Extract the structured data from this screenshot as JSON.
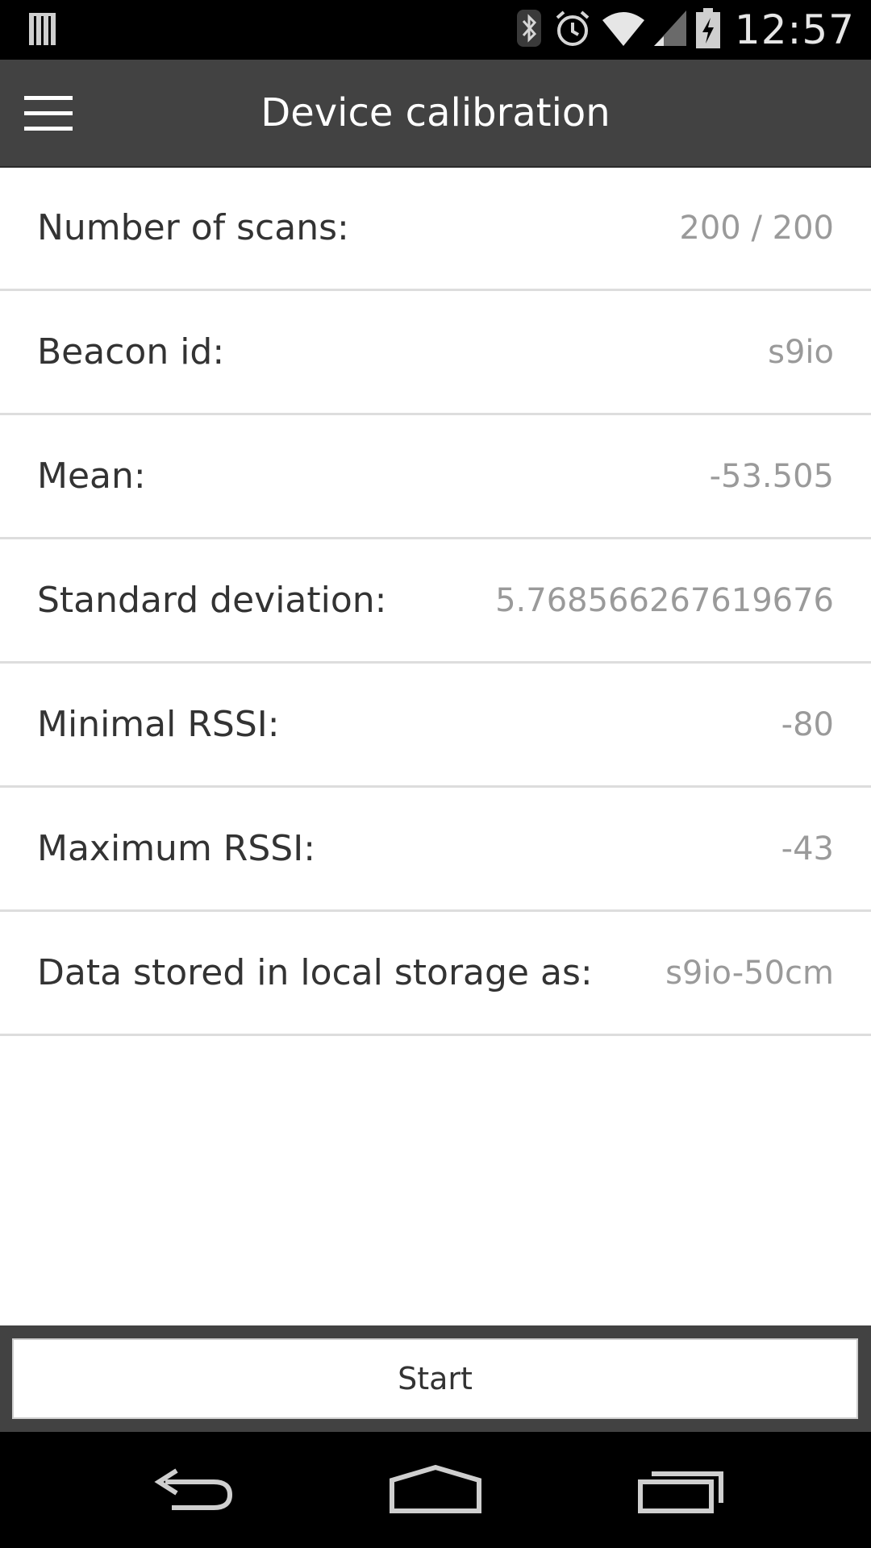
{
  "status_bar": {
    "time": "12:57",
    "icons": [
      "notification-icon",
      "bluetooth-icon",
      "alarm-icon",
      "wifi-icon",
      "signal-icon",
      "battery-charging-icon"
    ]
  },
  "app_bar": {
    "title": "Device calibration",
    "menu_icon": "hamburger-menu-icon"
  },
  "rows": [
    {
      "label": "Number of scans:",
      "value": "200 / 200"
    },
    {
      "label": "Beacon id:",
      "value": "s9io"
    },
    {
      "label": "Mean:",
      "value": "-53.505"
    },
    {
      "label": "Standard deviation:",
      "value": "5.768566267619676"
    },
    {
      "label": "Minimal RSSI:",
      "value": "-80"
    },
    {
      "label": "Maximum RSSI:",
      "value": "-43"
    },
    {
      "label": "Data stored in local storage as:",
      "value": "s9io-50cm"
    }
  ],
  "actions": {
    "start_label": "Start"
  },
  "nav_bar": {
    "icons": [
      "back-icon",
      "home-icon",
      "recents-icon"
    ]
  }
}
